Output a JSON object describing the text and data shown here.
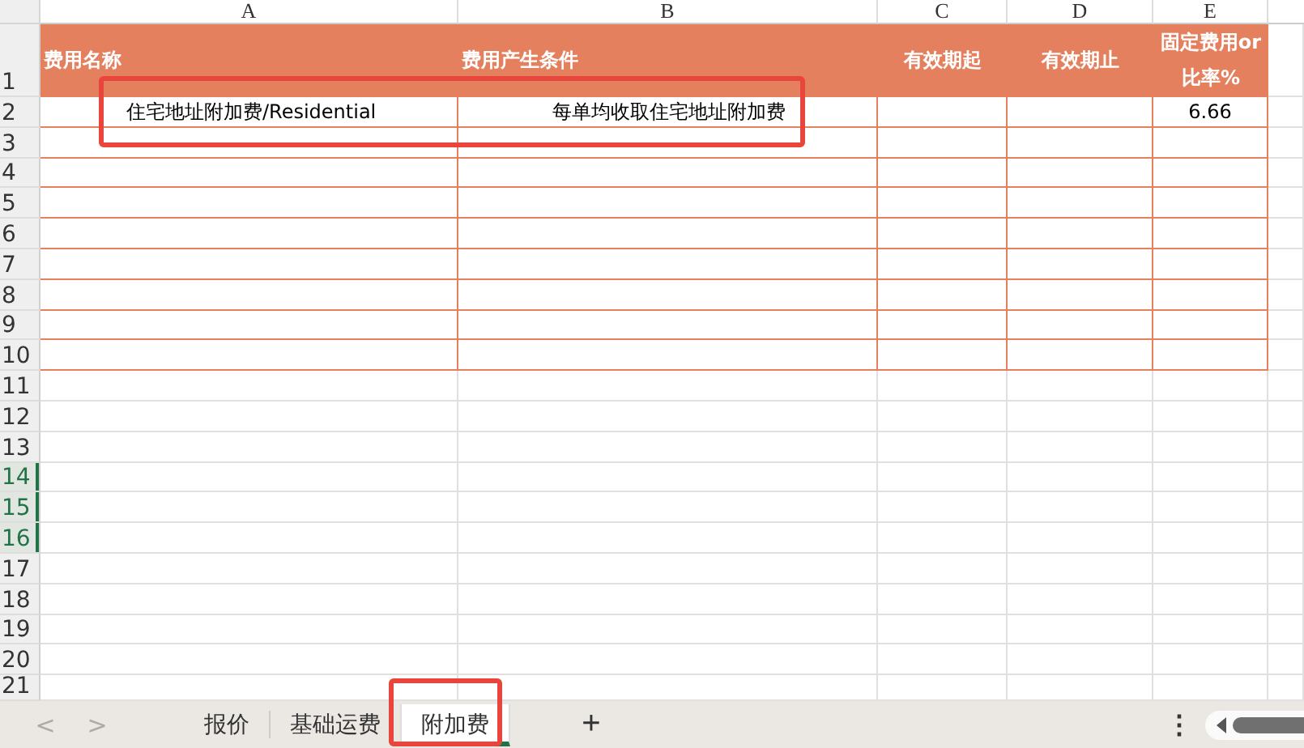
{
  "columns": [
    "A",
    "B",
    "C",
    "D",
    "E"
  ],
  "header_row": {
    "row": "1",
    "selected": false,
    "cells": [
      "费用名称",
      "费用产生条件",
      "有效期起",
      "有效期止",
      "固定费用or比率%"
    ]
  },
  "rows": [
    {
      "row": "2",
      "selected": false,
      "kind": "table",
      "cells": {
        "A": "住宅地址附加费/Residential",
        "B": "每单均收取住宅地址附加费",
        "E": "6.66"
      }
    },
    {
      "row": "3",
      "selected": false,
      "kind": "table"
    },
    {
      "row": "4",
      "selected": false,
      "kind": "table"
    },
    {
      "row": "5",
      "selected": false,
      "kind": "table"
    },
    {
      "row": "6",
      "selected": false,
      "kind": "table"
    },
    {
      "row": "7",
      "selected": false,
      "kind": "table"
    },
    {
      "row": "8",
      "selected": false,
      "kind": "table"
    },
    {
      "row": "9",
      "selected": false,
      "kind": "table"
    },
    {
      "row": "10",
      "selected": false,
      "kind": "table"
    },
    {
      "row": "11",
      "selected": false,
      "kind": "plain"
    },
    {
      "row": "12",
      "selected": false,
      "kind": "plain"
    },
    {
      "row": "13",
      "selected": false,
      "kind": "plain"
    },
    {
      "row": "14",
      "selected": true,
      "kind": "plain"
    },
    {
      "row": "15",
      "selected": true,
      "kind": "plain"
    },
    {
      "row": "16",
      "selected": true,
      "kind": "plain"
    },
    {
      "row": "17",
      "selected": false,
      "kind": "plain"
    },
    {
      "row": "18",
      "selected": false,
      "kind": "plain"
    },
    {
      "row": "19",
      "selected": false,
      "kind": "plain"
    },
    {
      "row": "20",
      "selected": false,
      "kind": "plain"
    },
    {
      "row": "21",
      "selected": false,
      "kind": "plain"
    }
  ],
  "nav": [
    "<",
    ">"
  ],
  "sheet_tabs": [
    {
      "label": "报价",
      "selected": false
    },
    {
      "label": "基础运费",
      "selected": false
    },
    {
      "label": "附加费",
      "selected": true
    }
  ],
  "add_sheet": "+",
  "more": "⋮"
}
